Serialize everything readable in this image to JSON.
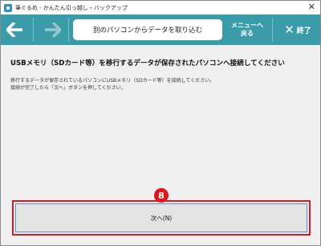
{
  "window": {
    "title": "筆ぐるめ - かんたん引っ越し・バックアップ",
    "close_glyph": "✕"
  },
  "toolbar": {
    "back_icon": "arrow-left-icon",
    "forward_icon": "arrow-right-icon",
    "center_label": "別のパソコンからデータを取り込む",
    "menu_back_line1": "メニューへ",
    "menu_back_line2": "戻る",
    "end_glyph": "✕",
    "end_label": "終了",
    "accent": "#3a9ca8"
  },
  "main": {
    "heading": "USBメモリ（SDカード等）を移行するデータが保存されたパソコンへ接続してください",
    "desc_line1": "移行するデータが保存されているパソコンにUSBメモリ（SDカード等）を接続してください。",
    "desc_line2": "接続が完了したら「次へ」ボタンを押してください。"
  },
  "annotation": {
    "step_number": "8",
    "color": "#e0161d"
  },
  "footer": {
    "next_label": "次へ(N)"
  }
}
